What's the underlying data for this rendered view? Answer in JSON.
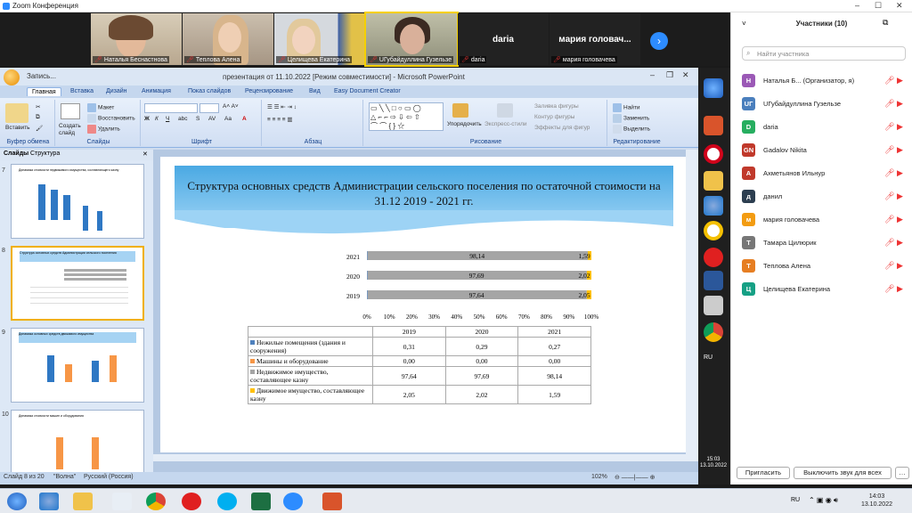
{
  "zoom": {
    "title": "Zoom Конференция",
    "strip_tiles": [
      {
        "name": "Наталья Беснастнова",
        "video": true
      },
      {
        "name": "Теплова Алена",
        "video": true
      },
      {
        "name": "Целищева Екатерина",
        "video": true
      },
      {
        "name": "UГубайдуллина Гузельзе",
        "video": true
      },
      {
        "name": "daria",
        "big": "daria",
        "video": false
      },
      {
        "name": "мария головачева",
        "big": "мария головач...",
        "video": false
      }
    ]
  },
  "ppt": {
    "quick_access": "Запись...",
    "title": "презентация от 11.10.2022 [Режим совместимости] - Microsoft PowerPoint",
    "tabs": [
      "Главная",
      "Вставка",
      "Дизайн",
      "Анимация",
      "Показ слайдов",
      "Рецензирование",
      "Вид",
      "Easy Document Creator"
    ],
    "ribbon": {
      "paste": "Вставить",
      "create_slide": "Создать слайд",
      "layout": "Макет",
      "reset": "Восстановить",
      "delete": "Удалить",
      "find": "Найти",
      "replace": "Заменить",
      "select": "Выделить",
      "arrange": "Упорядочить",
      "quick_styles": "Экспресс-стили",
      "fill": "Заливка фигуры",
      "outline": "Контур фигуры",
      "effects": "Эффекты для фигур",
      "groups": [
        "Буфер обмена",
        "Слайды",
        "Шрифт",
        "Абзац",
        "Рисование",
        "Редактирование"
      ]
    },
    "pane_tabs": [
      "Слайды",
      "Структура"
    ],
    "thumbs": [
      {
        "num": "7",
        "title": "Динамика стоимости недвижимого имущества, составляющего казну"
      },
      {
        "num": "8",
        "title": "Структура основных средств Администрации сельского поселения"
      },
      {
        "num": "9",
        "title": "Динамика основных средств движимого имущества"
      },
      {
        "num": "10",
        "title": "Динамика стоимости машин и оборудования"
      }
    ],
    "slide": {
      "title": "Структура основных средств Администрации сельского поселения по остаточной стоимости на 31.12 2019 - 2021 гг."
    },
    "status": {
      "slide": "Слайд 8 из 20",
      "theme": "\"Волна\"",
      "lang": "Русский (Россия)",
      "zoom": "102%"
    }
  },
  "chart_data": {
    "type": "bar",
    "orientation": "horizontal-stacked-100",
    "categories": [
      "2021",
      "2020",
      "2019"
    ],
    "series": [
      {
        "name": "Нежилые помещения (здания и сооружения)",
        "values": [
          0.27,
          0.29,
          0.31
        ],
        "color": "#4f81bd"
      },
      {
        "name": "Машины и оборудование",
        "values": [
          0.0,
          0.0,
          0.0
        ],
        "color": "#f79646"
      },
      {
        "name": "Недвижимое имущество, составляющее казну",
        "values": [
          98.14,
          97.69,
          97.64
        ],
        "color": "#a5a5a5"
      },
      {
        "name": "Движимое имущество, составляющее казну",
        "values": [
          1.59,
          2.02,
          2.05
        ],
        "color": "#ffc000"
      }
    ],
    "xticks": [
      "0%",
      "10%",
      "20%",
      "30%",
      "40%",
      "50%",
      "60%",
      "70%",
      "80%",
      "90%",
      "100%"
    ],
    "xlim": [
      0,
      100
    ],
    "table": {
      "years": [
        "2019",
        "2020",
        "2021"
      ],
      "rows": [
        {
          "label": "Нежилые помещения (здания и сооружения)",
          "values": [
            "0,31",
            "0,29",
            "0,27"
          ]
        },
        {
          "label": "Машины и оборудование",
          "values": [
            "0,00",
            "0,00",
            "0,00"
          ]
        },
        {
          "label": "Недвижимое имущество, составляющее казну",
          "values": [
            "97,64",
            "97,69",
            "98,14"
          ]
        },
        {
          "label": "Движимое имущество, составляющее казну",
          "values": [
            "2,05",
            "2,02",
            "1,59"
          ]
        }
      ]
    }
  },
  "participants": {
    "header": "Участники (10)",
    "search_placeholder": "Найти участника",
    "list": [
      {
        "initial": "Н",
        "name": "Наталья Б... (Организатор, я)",
        "color": "#9b59b6"
      },
      {
        "initial": "UГ",
        "name": "UГубайдуллина Гузельзе",
        "color": "#4a7fbd"
      },
      {
        "initial": "D",
        "name": "daria",
        "color": "#27ae60"
      },
      {
        "initial": "GN",
        "name": "Gadalov Nikita",
        "color": "#c0392b"
      },
      {
        "initial": "А",
        "name": "Ахметьянов Ильнур",
        "color": "#c0392b"
      },
      {
        "initial": "д",
        "name": "данил",
        "color": "#2c3e50"
      },
      {
        "initial": "м",
        "name": "мария головачева",
        "color": "#f39c12"
      },
      {
        "initial": "Т",
        "name": "Тамара Цилюрик",
        "color": "#777"
      },
      {
        "initial": "Т",
        "name": "Теплова Алена",
        "color": "#e67e22"
      },
      {
        "initial": "Ц",
        "name": "Целищева Екатерина",
        "color": "#16a085"
      }
    ],
    "invite_label": "Пригласить",
    "unmute_all_label": "Выключить звук для всех"
  },
  "taskbar": {
    "lang": "RU",
    "time": "14:03",
    "date": "13.10.2022",
    "lang_small": "RU",
    "time_small": "15:03",
    "date_small": "13.10.2022"
  }
}
